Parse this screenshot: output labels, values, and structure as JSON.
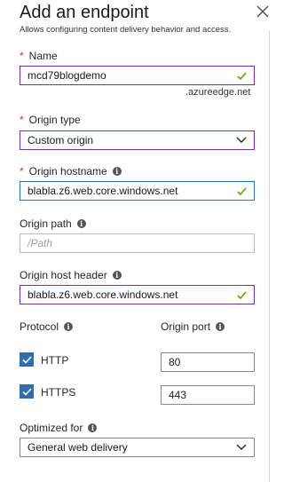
{
  "header": {
    "title": "Add an endpoint",
    "subtitle": "Allows configuring content delivery behavior and access.",
    "close_icon": "close-icon"
  },
  "form": {
    "name": {
      "label": "Name",
      "required": true,
      "value": "mcd79blogdemo",
      "suffix": ".azureedge.net",
      "valid": true
    },
    "origin_type": {
      "label": "Origin type",
      "required": true,
      "selected": "Custom origin"
    },
    "origin_hostname": {
      "label": "Origin hostname",
      "required": true,
      "value": "blabla.z6.web.core.windows.net",
      "valid": true
    },
    "origin_path": {
      "label": "Origin path",
      "placeholder": "/Path",
      "value": ""
    },
    "origin_host_header": {
      "label": "Origin host header",
      "value": "blabla.z6.web.core.windows.net",
      "valid": true
    },
    "protocol": {
      "label": "Protocol",
      "options": [
        {
          "label": "HTTP",
          "checked": true
        },
        {
          "label": "HTTPS",
          "checked": true
        }
      ]
    },
    "origin_port": {
      "label": "Origin port",
      "http_port": "80",
      "https_port": "443"
    },
    "optimized_for": {
      "label": "Optimized for",
      "selected": "General web delivery"
    }
  },
  "colors": {
    "required_star": "#d13438",
    "valid_check": "#5ea300",
    "checkbox_fill": "#2f6fb0",
    "focus_border": "#2f6fb0",
    "field_border_accent": "#7b2fa6"
  }
}
